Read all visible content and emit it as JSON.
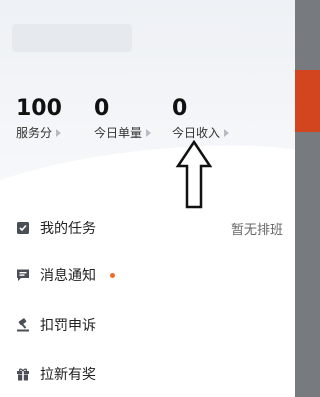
{
  "stats": [
    {
      "value": "100",
      "label": "服务分"
    },
    {
      "value": "0",
      "label": "今日单量"
    },
    {
      "value": "0",
      "label": "今日收入"
    }
  ],
  "menu": [
    {
      "label": "我的任务",
      "icon": "task-icon",
      "right": "暂无排班"
    },
    {
      "label": "消息通知",
      "icon": "message-icon",
      "badge": true
    },
    {
      "label": "扣罚申诉",
      "icon": "gavel-icon"
    },
    {
      "label": "拉新有奖",
      "icon": "gift-icon"
    }
  ],
  "colors": {
    "accent": "#f06a2c",
    "backdrop_red": "#d2451e",
    "icon": "#4a4f57"
  }
}
